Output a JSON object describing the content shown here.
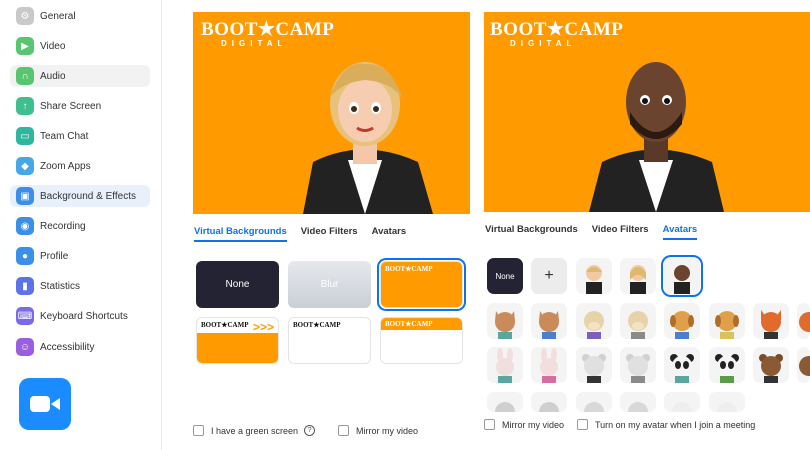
{
  "sidebar": {
    "items": [
      {
        "label": "General",
        "icon": "gear-icon",
        "color": "#c9c9c9"
      },
      {
        "label": "Video",
        "icon": "video-icon",
        "color": "#57c66e"
      },
      {
        "label": "Audio",
        "icon": "headphones-icon",
        "color": "#57c66e"
      },
      {
        "label": "Share Screen",
        "icon": "share-screen-icon",
        "color": "#3fbf8f"
      },
      {
        "label": "Team Chat",
        "icon": "chat-icon",
        "color": "#2fb5a0"
      },
      {
        "label": "Zoom Apps",
        "icon": "apps-icon",
        "color": "#44a8e6"
      },
      {
        "label": "Background & Effects",
        "icon": "background-icon",
        "color": "#3b8fe8"
      },
      {
        "label": "Recording",
        "icon": "recording-icon",
        "color": "#3b8fe8"
      },
      {
        "label": "Profile",
        "icon": "profile-icon",
        "color": "#3b8fe8"
      },
      {
        "label": "Statistics",
        "icon": "statistics-icon",
        "color": "#5b73e8"
      },
      {
        "label": "Keyboard Shortcuts",
        "icon": "keyboard-icon",
        "color": "#7b6ae8"
      },
      {
        "label": "Accessibility",
        "icon": "accessibility-icon",
        "color": "#9a5fe0"
      }
    ]
  },
  "left_panel": {
    "logo": "BOOT★CAMP",
    "logo_sub": "DIGITAL",
    "tabs": [
      "Virtual Backgrounds",
      "Video Filters",
      "Avatars"
    ],
    "active_tab": "Virtual Backgrounds",
    "tiles": {
      "none": "None",
      "blur": "Blur",
      "mini_logo": "BOOT★CAMP"
    },
    "green_screen": "I have a green screen",
    "mirror": "Mirror my video"
  },
  "right_panel": {
    "logo": "BOOT★CAMP",
    "logo_sub": "DIGITAL",
    "tabs": [
      "Virtual Backgrounds",
      "Video Filters",
      "Avatars"
    ],
    "active_tab": "Avatars",
    "avatar_none": "None",
    "avatar_add": "+",
    "mirror": "Mirror my video",
    "turn_on_avatar": "Turn on my avatar when I join a meeting"
  },
  "colors": {
    "accent": "#0e72ed",
    "brand_orange": "#ff9a00",
    "zoom_blue": "#1a8cff"
  }
}
